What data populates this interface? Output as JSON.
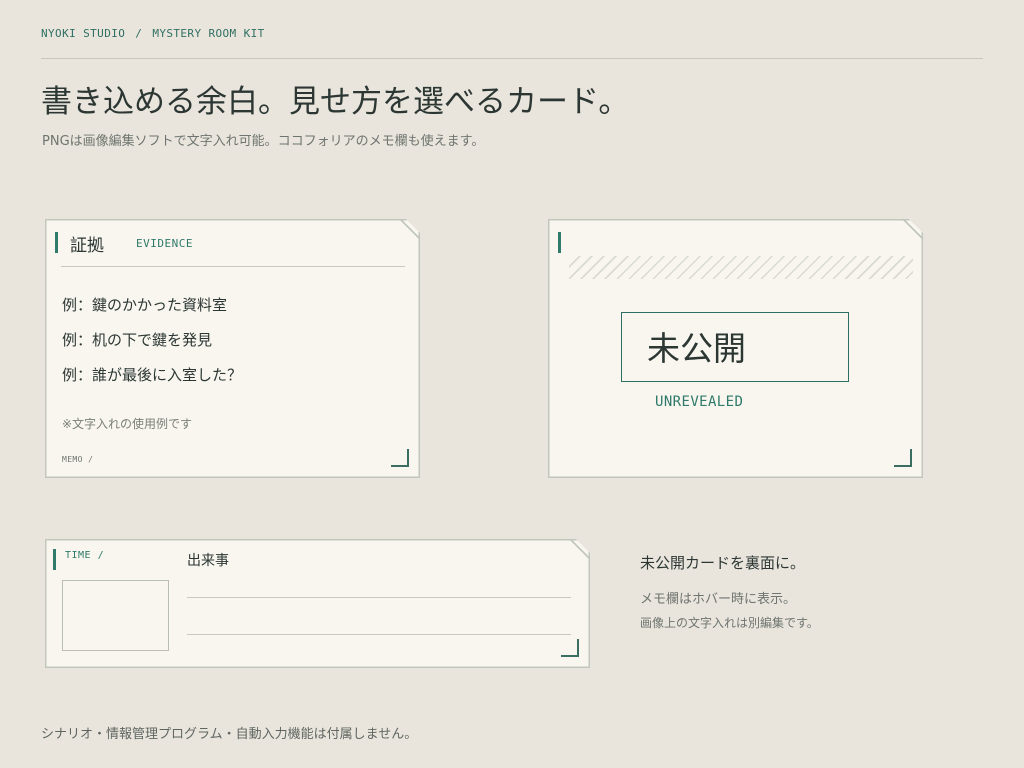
{
  "breadcrumb": {
    "studio": "NYOKI STUDIO",
    "separator": "/",
    "kit": "MYSTERY ROOM KIT"
  },
  "header": {
    "title": "書き込める余白。見せ方を選べるカード。",
    "subtitle": "PNGは画像編集ソフトで文字入れ可能。ココフォリアのメモ欄も使えます。"
  },
  "evidence_card": {
    "title": "証拠",
    "tag": "EVIDENCE",
    "items": [
      "例：鍵のかかった資料室",
      "例：机の下で鍵を発見",
      "例：誰が最後に入室した？"
    ],
    "note": "※文字入れの使用例です",
    "memo_label": "MEMO /"
  },
  "unrevealed_card": {
    "text": "未公開",
    "tag": "UNREVEALED"
  },
  "time_card": {
    "tag": "TIME /",
    "event_label": "出来事"
  },
  "side_notes": {
    "title": "未公開カードを裏面に。",
    "line1": "メモ欄はホバー時に表示。",
    "line2": "画像上の文字入れは別編集です。"
  },
  "footer": "シナリオ・情報管理プログラム・自動入力機能は付属しません。",
  "colors": {
    "background": "#e9e5dc",
    "card": "#f8f6ef",
    "accent": "#2f7a6a",
    "text": "#2c3734"
  }
}
